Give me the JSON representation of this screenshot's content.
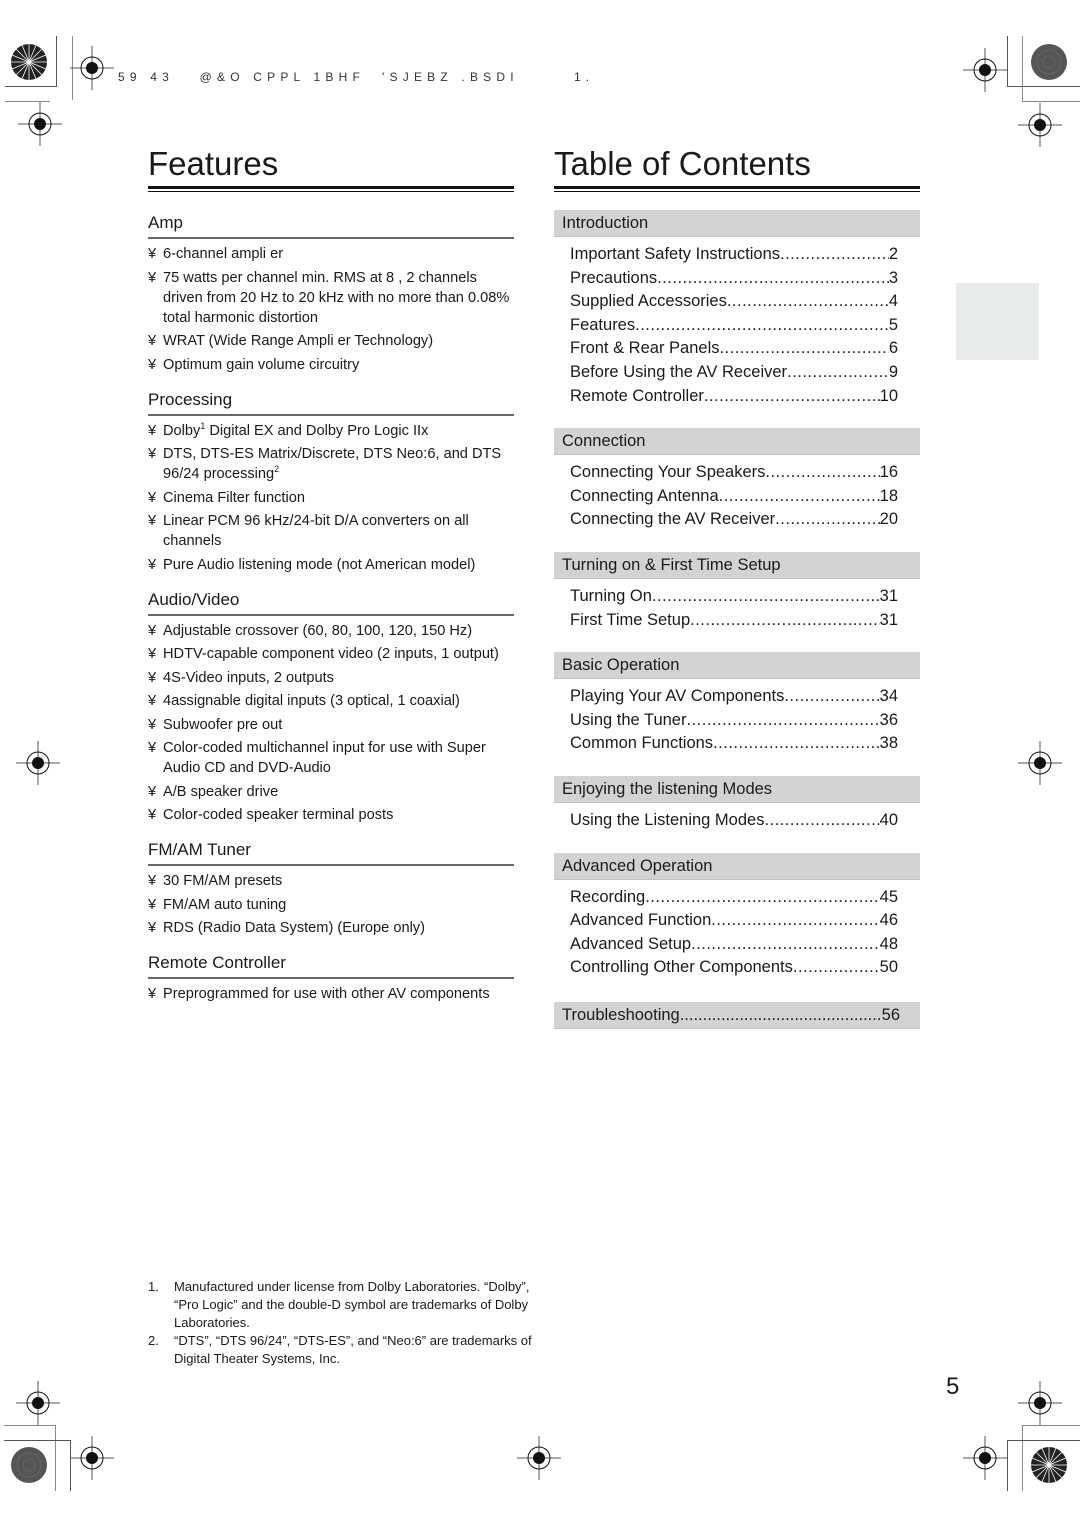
{
  "print_header": {
    "code": "59 43   @&O CPPL 1BHF  'SJEBZ .BSDI",
    "pm": "1."
  },
  "features": {
    "title": "Features",
    "sections": [
      {
        "heading": "Amp",
        "items": [
          {
            "bullet": "¥",
            "text": "6-channel ampli er"
          },
          {
            "bullet": "¥",
            "text": "75 watts per channel min. RMS at 8 , 2 channels driven from 20 Hz to 20 kHz with no more than 0.08% total harmonic distortion"
          },
          {
            "bullet": "¥",
            "text": "WRAT (Wide Range Ampli er Technology)"
          },
          {
            "bullet": "¥",
            "text": "Optimum gain volume circuitry"
          }
        ]
      },
      {
        "heading": "Processing",
        "items": [
          {
            "bullet": "¥",
            "text": "Dolby",
            "sup": "1",
            "text_after": " Digital EX and Dolby Pro Logic IIx"
          },
          {
            "bullet": "¥",
            "text": "DTS, DTS-ES Matrix/Discrete, DTS Neo:6, and DTS 96/24 processing",
            "sup": "2",
            "text_after": ""
          },
          {
            "bullet": "¥",
            "text": "Cinema Filter function"
          },
          {
            "bullet": "¥",
            "text": "Linear PCM 96 kHz/24-bit D/A converters on all channels"
          },
          {
            "bullet": "¥",
            "text": "Pure Audio listening mode (not American model)"
          }
        ]
      },
      {
        "heading": "Audio/Video",
        "items": [
          {
            "bullet": "¥",
            "text": "Adjustable crossover (60, 80, 100, 120, 150 Hz)"
          },
          {
            "bullet": "¥",
            "text": "HDTV-capable component video (2 inputs, 1 output)"
          },
          {
            "bullet": "¥",
            "text": " 4S-Video inputs, 2 outputs"
          },
          {
            "bullet": "¥",
            "text": " 4assignable digital inputs (3 optical, 1 coaxial)"
          },
          {
            "bullet": "¥",
            "text": "Subwoofer pre out"
          },
          {
            "bullet": "¥",
            "text": "Color-coded multichannel input for use with Super Audio CD and DVD-Audio"
          },
          {
            "bullet": "¥",
            "text": "A/B speaker drive"
          },
          {
            "bullet": "¥",
            "text": "Color-coded speaker terminal posts"
          }
        ]
      },
      {
        "heading": "FM/AM Tuner",
        "items": [
          {
            "bullet": "¥",
            "text": "30 FM/AM presets"
          },
          {
            "bullet": "¥",
            "text": "FM/AM auto tuning"
          },
          {
            "bullet": "¥",
            "text": "RDS (Radio Data System) (Europe only)"
          }
        ]
      },
      {
        "heading": "Remote Controller",
        "items": [
          {
            "bullet": "¥",
            "text": "Preprogrammed for use with other AV components"
          }
        ]
      }
    ]
  },
  "toc": {
    "title": "Table of Contents",
    "sections": [
      {
        "heading": "Introduction",
        "items": [
          {
            "title": "Important Safety Instructions",
            "page": "2"
          },
          {
            "title": "Precautions",
            "page": "3"
          },
          {
            "title": "Supplied Accessories",
            "page": "4"
          },
          {
            "title": "Features",
            "page": "5"
          },
          {
            "title": "Front & Rear Panels",
            "page": "6"
          },
          {
            "title": "Before Using the AV Receiver",
            "page": "9"
          },
          {
            "title": "Remote Controller",
            "page": "10"
          }
        ]
      },
      {
        "heading": "Connection",
        "items": [
          {
            "title": "Connecting Your Speakers",
            "page": "16"
          },
          {
            "title": "Connecting Antenna",
            "page": "18"
          },
          {
            "title": "Connecting the AV Receiver",
            "page": "20"
          }
        ]
      },
      {
        "heading": "Turning on & First Time Setup",
        "items": [
          {
            "title": "Turning On",
            "page": "31"
          },
          {
            "title": "First Time Setup",
            "page": "31"
          }
        ]
      },
      {
        "heading": "Basic Operation",
        "items": [
          {
            "title": "Playing Your AV Components",
            "page": "34"
          },
          {
            "title": "Using the Tuner",
            "page": "36"
          },
          {
            "title": "Common Functions",
            "page": "38"
          }
        ]
      },
      {
        "heading": "Enjoying the listening Modes",
        "items": [
          {
            "title": "Using the Listening Modes",
            "page": "40"
          }
        ]
      },
      {
        "heading": "Advanced Operation",
        "items": [
          {
            "title": "Recording",
            "page": "45"
          },
          {
            "title": "Advanced Function",
            "page": "46"
          },
          {
            "title": "Advanced Setup",
            "page": "48"
          },
          {
            "title": "Controlling Other Components",
            "page": "50"
          }
        ]
      }
    ],
    "troubleshooting": {
      "title": "Troubleshooting",
      "page": "56"
    }
  },
  "footnotes": [
    {
      "num": "1.",
      "text": "Manufactured under license from Dolby Laboratories. “Dolby”, “Pro Logic” and the double-D symbol are trademarks of Dolby Laboratories."
    },
    {
      "num": "2.",
      "text": "“DTS”, “DTS 96/24”, “DTS-ES”, and “Neo:6” are trademarks of Digital Theater Systems, Inc."
    }
  ],
  "page_number": "5",
  "colors": {
    "toc_heading_bg": "#d3d3d3",
    "side_tab_bg": "#e8eceb",
    "text": "#1a1a1a"
  }
}
